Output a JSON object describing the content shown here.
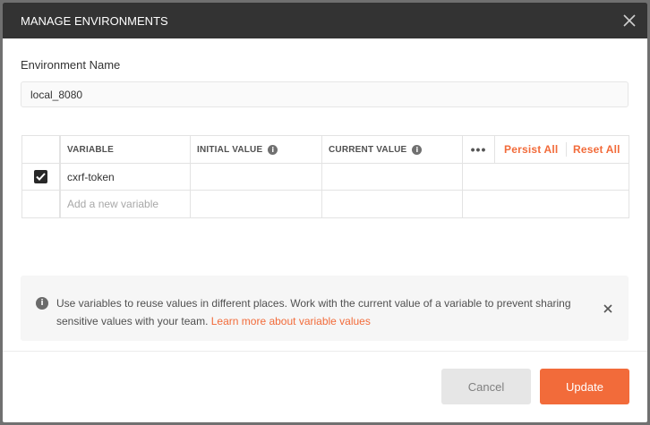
{
  "modal": {
    "title": "MANAGE ENVIRONMENTS"
  },
  "environment": {
    "label": "Environment Name",
    "value": "local_8080"
  },
  "table": {
    "headers": {
      "variable": "VARIABLE",
      "initial_value": "INITIAL VALUE",
      "current_value": "CURRENT VALUE",
      "more": "•••",
      "persist_all": "Persist All",
      "reset_all": "Reset All"
    },
    "rows": [
      {
        "checked": true,
        "variable": "cxrf-token",
        "initial_value": "",
        "current_value": ""
      }
    ],
    "new_variable_placeholder": "Add a new variable"
  },
  "banner": {
    "text": "Use variables to reuse values in different places. Work with the current value of a variable to prevent sharing sensitive values with your team.",
    "link": "Learn more about variable values"
  },
  "buttons": {
    "cancel": "Cancel",
    "update": "Update"
  },
  "icons": {
    "info": "i",
    "close": "close-icon",
    "check": "check-icon"
  },
  "colors": {
    "accent": "#f26b3a",
    "header_bg": "#333333"
  }
}
